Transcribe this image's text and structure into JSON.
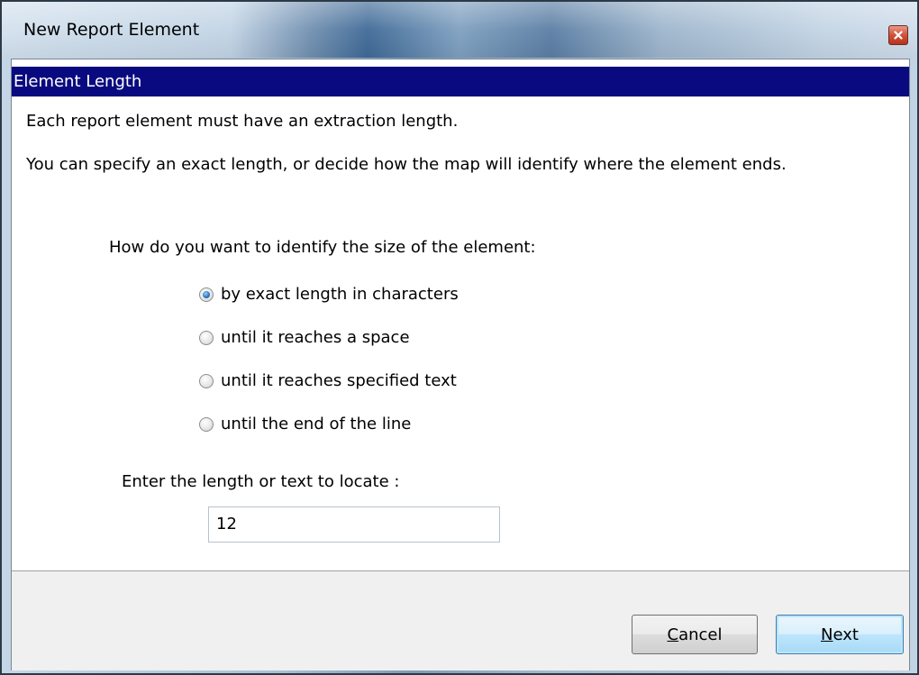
{
  "window": {
    "title": "New Report Element"
  },
  "header": {
    "title": "Element Length"
  },
  "intro": {
    "line1": "Each report element must have an extraction length.",
    "line2": "You can specify an exact length, or decide how the map will identify where the element ends."
  },
  "size_question": "How do you want to identify the size of the element:",
  "options": [
    {
      "label": "by exact length in characters",
      "selected": true
    },
    {
      "label": "until it reaches a space",
      "selected": false
    },
    {
      "label": "until it reaches specified text",
      "selected": false
    },
    {
      "label": "until the end of the line",
      "selected": false
    }
  ],
  "length_field": {
    "label": "Enter the length or text to locate :",
    "value": "12"
  },
  "buttons": {
    "cancel_mnemonic": "C",
    "cancel_rest": "ancel",
    "next_mnemonic": "N",
    "next_rest": "ext"
  },
  "colors": {
    "header_band": "#0a0a80",
    "default_button_border": "#3c7fb1",
    "close_button": "#c8452d"
  }
}
